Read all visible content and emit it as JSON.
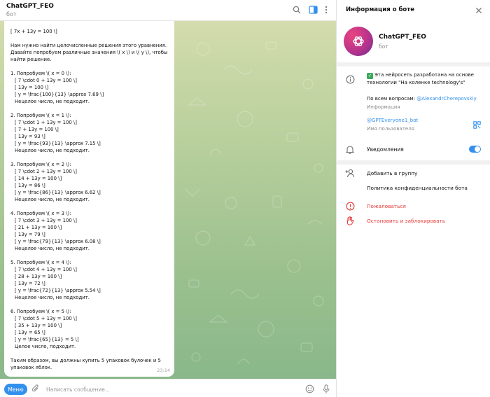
{
  "chat": {
    "title": "ChatGPT_FEO",
    "subtitle": "бот"
  },
  "header_icons": [
    "search-icon",
    "sidebar-toggle-icon",
    "more-vertical-icon"
  ],
  "message": {
    "lines": [
      {
        "t": "[ 7x + 13y = 100 \\]",
        "i": false
      },
      {
        "t": "",
        "i": false
      },
      {
        "t": "Нам нужно найти целочисленные решения этого уравнения.",
        "i": false
      },
      {
        "t": "Давайте попробуем различные значения \\( x \\) и \\( y \\), чтобы",
        "i": false
      },
      {
        "t": "найти решение.",
        "i": false
      },
      {
        "t": "",
        "i": false
      },
      {
        "t": "1. Попробуем \\( x = 0 \\):",
        "i": false
      },
      {
        "t": "[ 7 \\cdot 0 + 13y = 100 \\]",
        "i": true
      },
      {
        "t": "[ 13y = 100 \\]",
        "i": true
      },
      {
        "t": "[ y = \\frac{100}{13} \\approx 7.69 \\]",
        "i": true
      },
      {
        "t": "Нецелое число, не подходит.",
        "i": true
      },
      {
        "t": "",
        "i": false
      },
      {
        "t": "2. Попробуем \\( x = 1 \\):",
        "i": false
      },
      {
        "t": "[ 7 \\cdot 1 + 13y = 100 \\]",
        "i": true
      },
      {
        "t": "[ 7 + 13y = 100 \\]",
        "i": true
      },
      {
        "t": "[ 13y = 93 \\]",
        "i": true
      },
      {
        "t": "[ y = \\frac{93}{13} \\approx 7.15 \\]",
        "i": true
      },
      {
        "t": "Нецелое число, не подходит.",
        "i": true
      },
      {
        "t": "",
        "i": false
      },
      {
        "t": "3. Попробуем \\( x = 2 \\):",
        "i": false
      },
      {
        "t": "[ 7 \\cdot 2 + 13y = 100 \\]",
        "i": true
      },
      {
        "t": "[ 14 + 13y = 100 \\]",
        "i": true
      },
      {
        "t": "[ 13y = 86 \\]",
        "i": true
      },
      {
        "t": "[ y = \\frac{86}{13} \\approx 6.62 \\]",
        "i": true
      },
      {
        "t": "Нецелое число, не подходит.",
        "i": true
      },
      {
        "t": "",
        "i": false
      },
      {
        "t": "4. Попробуем \\( x = 3 \\):",
        "i": false
      },
      {
        "t": "[ 7 \\cdot 3 + 13y = 100 \\]",
        "i": true
      },
      {
        "t": "[ 21 + 13y = 100 \\]",
        "i": true
      },
      {
        "t": "[ 13y = 79 \\]",
        "i": true
      },
      {
        "t": "[ y = \\frac{79}{13} \\approx 6.08 \\]",
        "i": true
      },
      {
        "t": "Нецелое число, не подходит.",
        "i": true
      },
      {
        "t": "",
        "i": false
      },
      {
        "t": "5. Попробуем \\( x = 4 \\):",
        "i": false
      },
      {
        "t": "[ 7 \\cdot 4 + 13y = 100 \\]",
        "i": true
      },
      {
        "t": "[ 28 + 13y = 100 \\]",
        "i": true
      },
      {
        "t": "[ 13y = 72 \\]",
        "i": true
      },
      {
        "t": "[ y = \\frac{72}{13} \\approx 5.54 \\]",
        "i": true
      },
      {
        "t": "Нецелое число, не подходит.",
        "i": true
      },
      {
        "t": "",
        "i": false
      },
      {
        "t": "6. Попробуем \\( x = 5 \\):",
        "i": false
      },
      {
        "t": "[ 7 \\cdot 5 + 13y = 100 \\]",
        "i": true
      },
      {
        "t": "[ 35 + 13y = 100 \\]",
        "i": true
      },
      {
        "t": "[ 13y = 65 \\]",
        "i": true
      },
      {
        "t": "[ y = \\frac{65}{13} = 5 \\]",
        "i": true
      },
      {
        "t": "Целое число, подходит.",
        "i": true
      },
      {
        "t": "",
        "i": false
      },
      {
        "t": "Таким образом, вы должны купить 5 упаковок булочек и 5",
        "i": false
      },
      {
        "t": "упаковок яблок.",
        "i": false
      }
    ],
    "time": "23:14"
  },
  "composer": {
    "menu_label": "Меню",
    "placeholder": "Написать сообщение..."
  },
  "panel": {
    "title": "Информация о боте",
    "bot_name": "ChatGPT_FEO",
    "bot_status": "бот",
    "description_line1": "Эта нейросеть разработана на основе",
    "description_line2": "технологии \"На коленке technology's\"",
    "contact_prefix": "По всем вопросам: ",
    "contact_link": "@AlexandrCherepovskiy",
    "info_caption": "Информация",
    "username": "@GPTEveryone1_bot",
    "username_caption": "Имя пользователя",
    "notifications_label": "Уведомления",
    "notifications_on": true,
    "add_to_group": "Добавить в группу",
    "privacy_policy": "Политика конфиденциальности бота",
    "report": "Пожаловаться",
    "stop_block": "Остановить и заблокировать"
  },
  "colors": {
    "accent": "#3390ec",
    "danger": "#e53935",
    "check_green": "#3aa75a"
  }
}
